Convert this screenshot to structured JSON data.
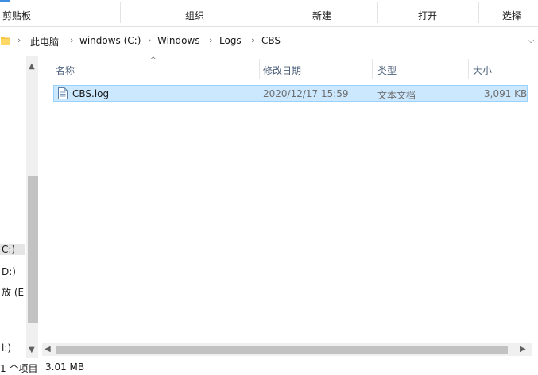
{
  "ribbon": {
    "groups": [
      "剪贴板",
      "组织",
      "新建",
      "打开",
      "选择"
    ]
  },
  "address": {
    "path": [
      "此电脑",
      "windows (C:)",
      "Windows",
      "Logs",
      "CBS"
    ],
    "separator": "›",
    "dropdown_glyph": "⌵"
  },
  "nav": {
    "items": [
      "C:)",
      "D:)",
      "放 (E",
      "l:)"
    ]
  },
  "columns": {
    "name": "名称",
    "modified": "修改日期",
    "type": "类型",
    "size": "大小"
  },
  "files": [
    {
      "name": "CBS.log",
      "modified": "2020/12/17 15:59",
      "type": "文本文档",
      "size": "3,091 KB"
    }
  ],
  "status": {
    "count": "1 个项目",
    "size": "3.01 MB"
  },
  "colors": {
    "selection_bg": "#cce8ff",
    "selection_border": "#99d1ff",
    "header_text": "#4c607a",
    "folder_yellow": "#f5c445"
  }
}
